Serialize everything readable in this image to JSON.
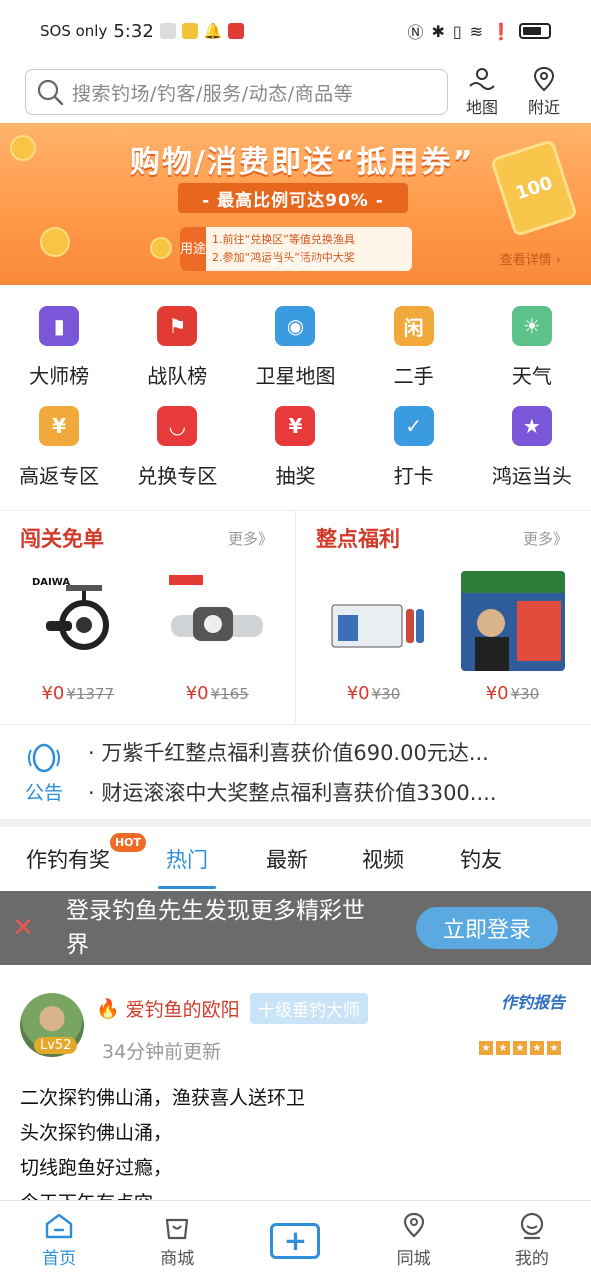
{
  "status": {
    "carrier": "SOS only",
    "time": "5:32"
  },
  "search": {
    "placeholder": "搜索钓场/钓客/服务/动态/商品等",
    "map_label": "地图",
    "nearby_label": "附近"
  },
  "banner": {
    "title": "购物/消费即送“抵用券”",
    "subtitle": "- 最高比例可达90% -",
    "use_tag": "用途",
    "line1": "1.前往“兑换区”等值兑换渔具",
    "line2": "2.参加“鸿运当头”活动中大奖",
    "more": "查看详情 ›",
    "ticket_value": "100"
  },
  "grid": {
    "row1": [
      {
        "label": "大师榜",
        "icon": "ranking-icon",
        "color": "#7a57d8"
      },
      {
        "label": "战队榜",
        "icon": "flag-icon",
        "color": "#e23b33"
      },
      {
        "label": "卫星地图",
        "icon": "map-pin-icon",
        "color": "#3b9be0"
      },
      {
        "label": "二手",
        "icon": "secondhand-icon",
        "color": "#f2a93b"
      },
      {
        "label": "天气",
        "icon": "weather-icon",
        "color": "#5cc28a"
      }
    ],
    "row2": [
      {
        "label": "高返专区",
        "icon": "coupon-icon",
        "color": "#f2a93b"
      },
      {
        "label": "兑换专区",
        "icon": "shopping-bag-icon",
        "color": "#e8393b"
      },
      {
        "label": "抽奖",
        "icon": "gift-icon",
        "color": "#e8393b"
      },
      {
        "label": "打卡",
        "icon": "checkin-icon",
        "color": "#3b9be0"
      },
      {
        "label": "鸿运当头",
        "icon": "medal-icon",
        "color": "#7a57d8"
      }
    ]
  },
  "promo": {
    "left": {
      "title": "闯关免单",
      "more": "更多》",
      "items": [
        {
          "price": "¥0",
          "old": "¥1377"
        },
        {
          "price": "¥0",
          "old": "¥165"
        }
      ]
    },
    "right": {
      "title": "整点福利",
      "more": "更多》",
      "items": [
        {
          "price": "¥0",
          "old": "¥30"
        },
        {
          "price": "¥0",
          "old": "¥30"
        }
      ]
    }
  },
  "notice": {
    "label": "公告",
    "lines": [
      "· 万紫千红整点福利喜获价值690.00元达...",
      "· 财运滚滚中大奖整点福利喜获价值3300...."
    ]
  },
  "tabs": [
    {
      "label": "作钓有奖",
      "badge": "HOT"
    },
    {
      "label": "热门"
    },
    {
      "label": "最新"
    },
    {
      "label": "视频"
    },
    {
      "label": "钓友"
    }
  ],
  "login": {
    "message": "登录钓鱼先生发现更多精彩世界",
    "button": "立即登录"
  },
  "post": {
    "username": "爱钓鱼的欧阳",
    "rank": "十级垂钓大师",
    "level": "Lv52",
    "time": "34分钟前更新",
    "report_label": "作钓报告",
    "lines": [
      "二次探钓佛山涌，渔获喜人送环卫",
      "头次探钓佛山涌，",
      "切线跑鱼好过瘾，",
      "今天下午有点空"
    ]
  },
  "nav": [
    {
      "label": "首页"
    },
    {
      "label": "商城"
    },
    {
      "label": ""
    },
    {
      "label": "同城"
    },
    {
      "label": "我的"
    }
  ]
}
